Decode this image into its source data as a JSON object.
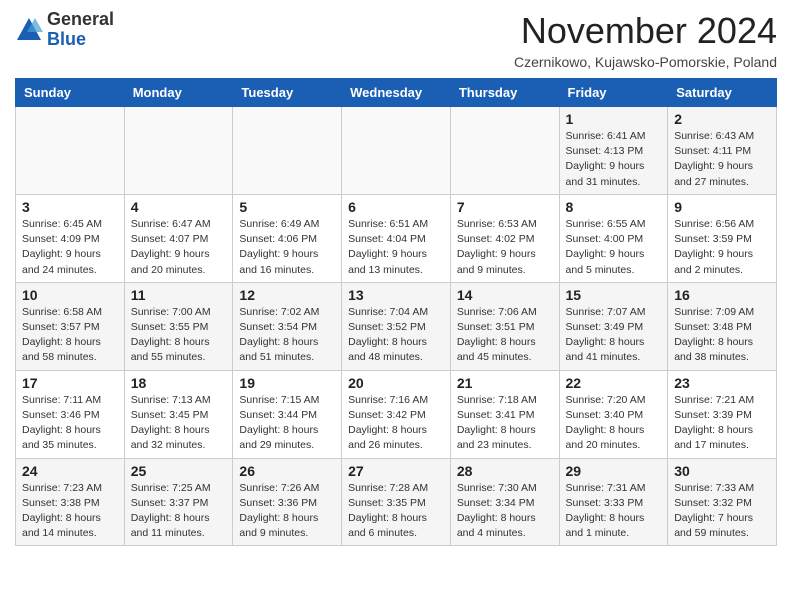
{
  "header": {
    "logo_general": "General",
    "logo_blue": "Blue",
    "month_title": "November 2024",
    "location": "Czernikowo, Kujawsko-Pomorskie, Poland"
  },
  "weekdays": [
    "Sunday",
    "Monday",
    "Tuesday",
    "Wednesday",
    "Thursday",
    "Friday",
    "Saturday"
  ],
  "weeks": [
    [
      {
        "day": "",
        "info": ""
      },
      {
        "day": "",
        "info": ""
      },
      {
        "day": "",
        "info": ""
      },
      {
        "day": "",
        "info": ""
      },
      {
        "day": "",
        "info": ""
      },
      {
        "day": "1",
        "info": "Sunrise: 6:41 AM\nSunset: 4:13 PM\nDaylight: 9 hours and 31 minutes."
      },
      {
        "day": "2",
        "info": "Sunrise: 6:43 AM\nSunset: 4:11 PM\nDaylight: 9 hours and 27 minutes."
      }
    ],
    [
      {
        "day": "3",
        "info": "Sunrise: 6:45 AM\nSunset: 4:09 PM\nDaylight: 9 hours and 24 minutes."
      },
      {
        "day": "4",
        "info": "Sunrise: 6:47 AM\nSunset: 4:07 PM\nDaylight: 9 hours and 20 minutes."
      },
      {
        "day": "5",
        "info": "Sunrise: 6:49 AM\nSunset: 4:06 PM\nDaylight: 9 hours and 16 minutes."
      },
      {
        "day": "6",
        "info": "Sunrise: 6:51 AM\nSunset: 4:04 PM\nDaylight: 9 hours and 13 minutes."
      },
      {
        "day": "7",
        "info": "Sunrise: 6:53 AM\nSunset: 4:02 PM\nDaylight: 9 hours and 9 minutes."
      },
      {
        "day": "8",
        "info": "Sunrise: 6:55 AM\nSunset: 4:00 PM\nDaylight: 9 hours and 5 minutes."
      },
      {
        "day": "9",
        "info": "Sunrise: 6:56 AM\nSunset: 3:59 PM\nDaylight: 9 hours and 2 minutes."
      }
    ],
    [
      {
        "day": "10",
        "info": "Sunrise: 6:58 AM\nSunset: 3:57 PM\nDaylight: 8 hours and 58 minutes."
      },
      {
        "day": "11",
        "info": "Sunrise: 7:00 AM\nSunset: 3:55 PM\nDaylight: 8 hours and 55 minutes."
      },
      {
        "day": "12",
        "info": "Sunrise: 7:02 AM\nSunset: 3:54 PM\nDaylight: 8 hours and 51 minutes."
      },
      {
        "day": "13",
        "info": "Sunrise: 7:04 AM\nSunset: 3:52 PM\nDaylight: 8 hours and 48 minutes."
      },
      {
        "day": "14",
        "info": "Sunrise: 7:06 AM\nSunset: 3:51 PM\nDaylight: 8 hours and 45 minutes."
      },
      {
        "day": "15",
        "info": "Sunrise: 7:07 AM\nSunset: 3:49 PM\nDaylight: 8 hours and 41 minutes."
      },
      {
        "day": "16",
        "info": "Sunrise: 7:09 AM\nSunset: 3:48 PM\nDaylight: 8 hours and 38 minutes."
      }
    ],
    [
      {
        "day": "17",
        "info": "Sunrise: 7:11 AM\nSunset: 3:46 PM\nDaylight: 8 hours and 35 minutes."
      },
      {
        "day": "18",
        "info": "Sunrise: 7:13 AM\nSunset: 3:45 PM\nDaylight: 8 hours and 32 minutes."
      },
      {
        "day": "19",
        "info": "Sunrise: 7:15 AM\nSunset: 3:44 PM\nDaylight: 8 hours and 29 minutes."
      },
      {
        "day": "20",
        "info": "Sunrise: 7:16 AM\nSunset: 3:42 PM\nDaylight: 8 hours and 26 minutes."
      },
      {
        "day": "21",
        "info": "Sunrise: 7:18 AM\nSunset: 3:41 PM\nDaylight: 8 hours and 23 minutes."
      },
      {
        "day": "22",
        "info": "Sunrise: 7:20 AM\nSunset: 3:40 PM\nDaylight: 8 hours and 20 minutes."
      },
      {
        "day": "23",
        "info": "Sunrise: 7:21 AM\nSunset: 3:39 PM\nDaylight: 8 hours and 17 minutes."
      }
    ],
    [
      {
        "day": "24",
        "info": "Sunrise: 7:23 AM\nSunset: 3:38 PM\nDaylight: 8 hours and 14 minutes."
      },
      {
        "day": "25",
        "info": "Sunrise: 7:25 AM\nSunset: 3:37 PM\nDaylight: 8 hours and 11 minutes."
      },
      {
        "day": "26",
        "info": "Sunrise: 7:26 AM\nSunset: 3:36 PM\nDaylight: 8 hours and 9 minutes."
      },
      {
        "day": "27",
        "info": "Sunrise: 7:28 AM\nSunset: 3:35 PM\nDaylight: 8 hours and 6 minutes."
      },
      {
        "day": "28",
        "info": "Sunrise: 7:30 AM\nSunset: 3:34 PM\nDaylight: 8 hours and 4 minutes."
      },
      {
        "day": "29",
        "info": "Sunrise: 7:31 AM\nSunset: 3:33 PM\nDaylight: 8 hours and 1 minute."
      },
      {
        "day": "30",
        "info": "Sunrise: 7:33 AM\nSunset: 3:32 PM\nDaylight: 7 hours and 59 minutes."
      }
    ]
  ]
}
